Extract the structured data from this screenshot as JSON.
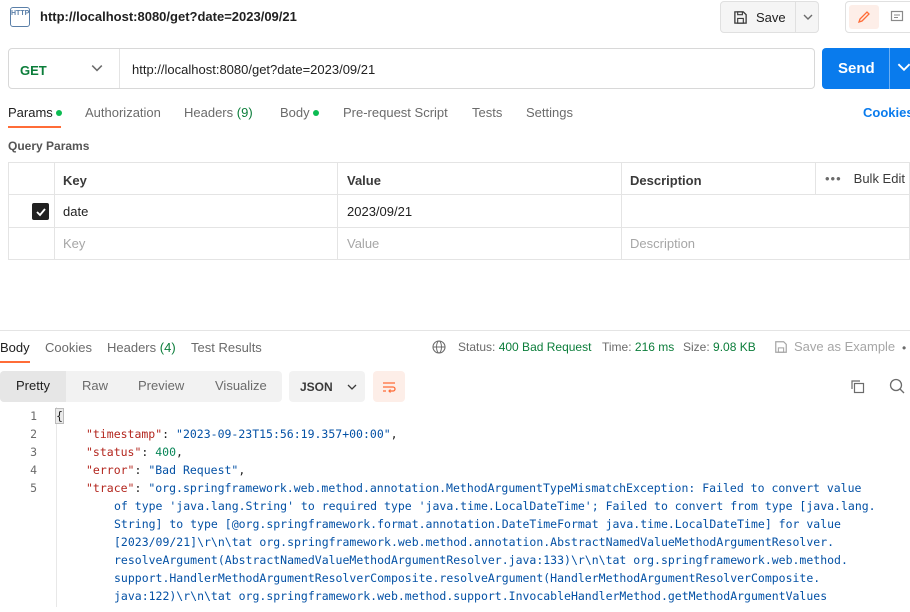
{
  "titlebar": {
    "icon_text": "HTTP",
    "title": "http://localhost:8080/get?date=2023/09/21",
    "save_label": "Save"
  },
  "request": {
    "method": "GET",
    "url": "http://localhost:8080/get?date=2023/09/21",
    "send_label": "Send"
  },
  "tabs": {
    "params": "Params",
    "authorization": "Authorization",
    "headers": "Headers",
    "headers_count": "(9)",
    "body": "Body",
    "prerequest": "Pre-request Script",
    "tests": "Tests",
    "settings": "Settings",
    "cookies": "Cookies"
  },
  "query_params": {
    "section_title": "Query Params",
    "columns": {
      "key": "Key",
      "value": "Value",
      "description": "Description"
    },
    "bulk_edit": "Bulk Edit",
    "rows": [
      {
        "key": "date",
        "value": "2023/09/21",
        "description": ""
      }
    ],
    "placeholder": {
      "key": "Key",
      "value": "Value",
      "description": "Description"
    }
  },
  "response": {
    "tabs": {
      "body": "Body",
      "cookies": "Cookies",
      "headers": "Headers",
      "headers_count": "(4)",
      "test_results": "Test Results"
    },
    "status_label": "Status:",
    "status_value": "400 Bad Request",
    "time_label": "Time:",
    "time_value": "216 ms",
    "size_label": "Size:",
    "size_value": "9.08 KB",
    "save_example": "Save as Example",
    "formats": [
      "Pretty",
      "Raw",
      "Preview",
      "Visualize"
    ],
    "content_type": "JSON"
  },
  "code_lines": [
    {
      "n": "1",
      "text": "{"
    },
    {
      "n": "2",
      "k": "\"timestamp\"",
      "v": "\"2023-09-23T15:56:19.357+00:00\"",
      "type": "str"
    },
    {
      "n": "3",
      "k": "\"status\"",
      "v": "400",
      "type": "num"
    },
    {
      "n": "4",
      "k": "\"error\"",
      "v": "\"Bad Request\"",
      "type": "str"
    },
    {
      "n": "5",
      "k": "\"trace\"",
      "v": "\"org.springframework.web.method.annotation.MethodArgumentTypeMismatchException: Failed to convert value",
      "type": "str"
    }
  ],
  "trace_wrap": [
    "of type 'java.lang.String' to required type 'java.time.LocalDateTime'; Failed to convert from type [java.lang.",
    "String] to type [@org.springframework.format.annotation.DateTimeFormat java.time.LocalDateTime] for value",
    "[2023/09/21]\\r\\n\\tat org.springframework.web.method.annotation.AbstractNamedValueMethodArgumentResolver.",
    "resolveArgument(AbstractNamedValueMethodArgumentResolver.java:133)\\r\\n\\tat org.springframework.web.method.",
    "support.HandlerMethodArgumentResolverComposite.resolveArgument(HandlerMethodArgumentResolverComposite.",
    "java:122)\\r\\n\\tat org.springframework.web.method.support.InvocableHandlerMethod.getMethodArgumentValues"
  ]
}
